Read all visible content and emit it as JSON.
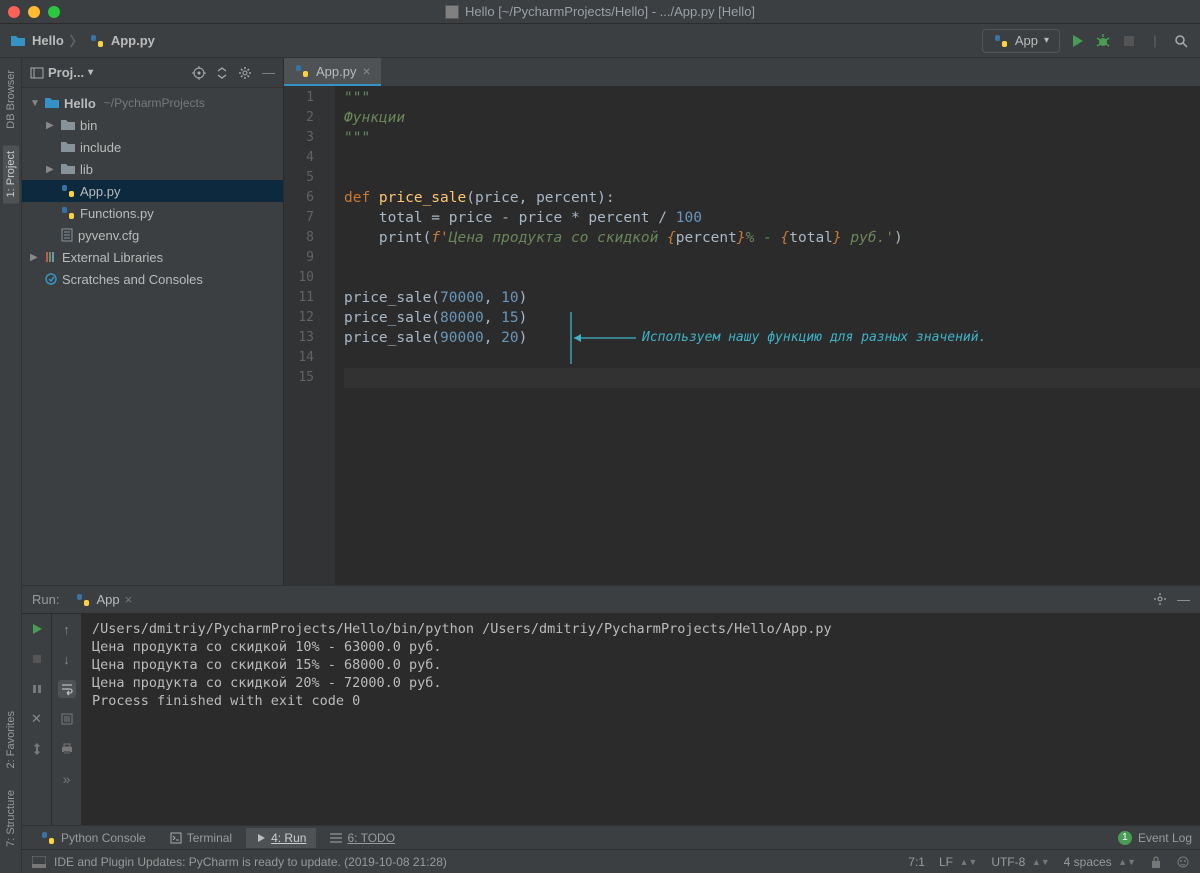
{
  "window": {
    "title": "Hello [~/PycharmProjects/Hello] - .../App.py [Hello]"
  },
  "breadcrumb": {
    "root": "Hello",
    "file": "App.py"
  },
  "run_config": {
    "label": "App"
  },
  "project_panel": {
    "title": "Proj...",
    "tree": {
      "root_name": "Hello",
      "root_path": "~/PycharmProjects",
      "items": [
        {
          "label": "bin"
        },
        {
          "label": "include"
        },
        {
          "label": "lib"
        },
        {
          "label": "App.py"
        },
        {
          "label": "Functions.py"
        },
        {
          "label": "pyvenv.cfg"
        }
      ],
      "ext_libs": "External Libraries",
      "scratches": "Scratches and Consoles"
    }
  },
  "gutter_tabs": {
    "db": "DB Browser",
    "project": "1: Project",
    "favorites": "2: Favorites",
    "structure": "7: Structure"
  },
  "editor": {
    "tab_name": "App.py",
    "comment_text": "Функции",
    "code": {
      "def_kw": "def ",
      "fn_name": "price_sale",
      "params": "(price, percent):",
      "assign": "    total = price - price * percent / ",
      "hundred": "100",
      "print_open": "    print(",
      "fprefix": "f'",
      "str1": "Цена продукта со скидкой ",
      "br": "{",
      "var1": "percent",
      "brc": "}",
      "str2": "% - ",
      "var2": "total",
      "str3": " руб.'",
      "close": ")",
      "call1_a": "price_sale(",
      "call1_n1": "70000",
      "call1_sep": ", ",
      "call1_n2": "10",
      "call1_c": ")",
      "call2_a": "price_sale(",
      "call2_n1": "80000",
      "call2_sep": ", ",
      "call2_n2": "15",
      "call2_c": ")",
      "call3_a": "price_sale(",
      "call3_n1": "90000",
      "call3_sep": ", ",
      "call3_n2": "20",
      "call3_c": ")"
    },
    "lines": [
      "1",
      "2",
      "3",
      "4",
      "5",
      "6",
      "7",
      "8",
      "9",
      "10",
      "11",
      "12",
      "13",
      "14",
      "15"
    ],
    "annotation": "Используем нашу функцию для разных значений."
  },
  "run_panel": {
    "label": "Run:",
    "tab": "App",
    "output": [
      "/Users/dmitriy/PycharmProjects/Hello/bin/python /Users/dmitriy/PycharmProjects/Hello/App.py",
      "Цена продукта со скидкой 10% - 63000.0 руб.",
      "Цена продукта со скидкой 15% - 68000.0 руб.",
      "Цена продукта со скидкой 20% - 72000.0 руб.",
      "",
      "Process finished with exit code 0"
    ]
  },
  "bottom_tabs": {
    "py_console": "Python Console",
    "terminal": "Terminal",
    "run": "4: Run",
    "todo": "6: TODO",
    "event_log": "Event Log",
    "event_badge": "1"
  },
  "status": {
    "message": "IDE and Plugin Updates: PyCharm is ready to update. (2019-10-08 21:28)",
    "position": "7:1",
    "line_sep": "LF",
    "encoding": "UTF-8",
    "indent": "4 spaces"
  }
}
